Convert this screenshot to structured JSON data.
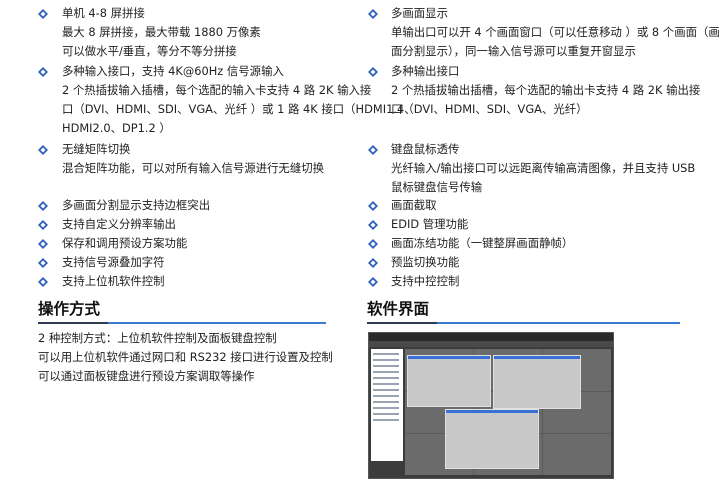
{
  "colors": {
    "bullet": "#2b5fbf",
    "heading_bar_dark": "#2f3b52",
    "heading_bar_blue": "#3a7bd5"
  },
  "left": {
    "features": [
      {
        "title": "单机 4-8 屏拼接",
        "lines": [
          "最大 8 屏拼接，最大带载 1880 万像素",
          "可以做水平/垂直，等分不等分拼接"
        ]
      },
      {
        "title": "多种输入接口，支持 4K@60Hz 信号源输入",
        "lines": [
          "2 个热插拔输入插槽，每个选配的输入卡支持 4 路 2K 输入接",
          "口（DVI、HDMI、SDI、VGA、光纤 ）或 1 路 4K 接口（HDMI1.4、",
          "HDMI2.0、DP1.2 ）"
        ]
      },
      {
        "title": "无缝矩阵切换",
        "lines": [
          "混合矩阵功能，可以对所有输入信号源进行无缝切换"
        ]
      },
      {
        "title": "多画面分割显示支持边框突出",
        "lines": []
      },
      {
        "title": "支持自定义分辨率输出",
        "lines": []
      },
      {
        "title": "保存和调用预设方案功能",
        "lines": []
      },
      {
        "title": "支持信号源叠加字符",
        "lines": []
      },
      {
        "title": "支持上位机软件控制",
        "lines": []
      }
    ],
    "section_title": "操作方式",
    "operation_lines": [
      "2 种控制方式：上位机软件控制及面板键盘控制",
      "可以用上位机软件通过网口和 RS232 接口进行设置及控制",
      "可以通过面板键盘进行预设方案调取等操作"
    ]
  },
  "right": {
    "features": [
      {
        "title": "多画面显示",
        "lines": [
          "单输出口可以开 4 个画面窗口（可以任意移动 ）或 8 个画面（画",
          "面分割显示），同一输入信号源可以重复开窗显示"
        ]
      },
      {
        "title": "多种输出接口",
        "lines": [
          "2 个热插拔输出插槽，每个选配的输出卡支持 4 路 2K 输出接",
          "口（DVI、HDMI、SDI、VGA、光纤）"
        ]
      },
      {
        "title": "键盘鼠标透传",
        "lines": [
          "光纤输入/输出接口可以远距离传输高清图像，并且支持 USB",
          "鼠标键盘信号传输"
        ]
      },
      {
        "title": "画面截取",
        "lines": []
      },
      {
        "title": "EDID 管理功能",
        "lines": []
      },
      {
        "title": "画面冻结功能（一键整屏画面静帧）",
        "lines": []
      },
      {
        "title": "预监切换功能",
        "lines": []
      },
      {
        "title": "支持中控控制",
        "lines": []
      }
    ],
    "section_title": "软件界面",
    "screenshot_icon": "software-ui-screenshot"
  }
}
